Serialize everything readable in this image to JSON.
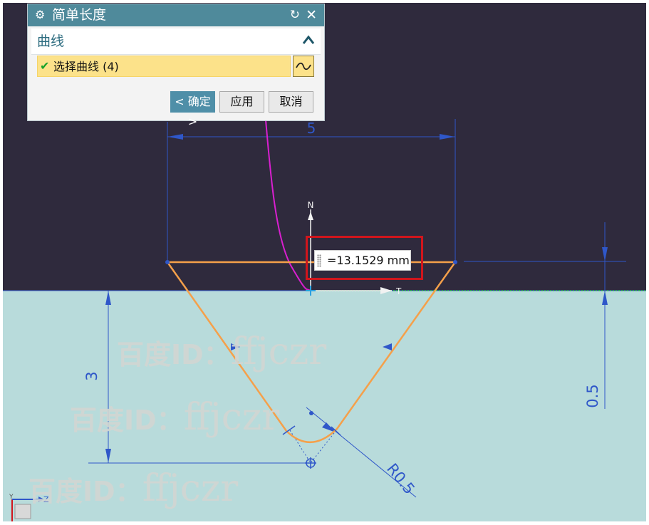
{
  "dialog": {
    "title": "简单长度",
    "icons": {
      "settings": "gear-icon",
      "reset": "reset-icon",
      "close": "close-icon"
    },
    "section": {
      "title": "曲线",
      "collapse_icon": "chevron-up-icon"
    },
    "select_curve": {
      "label": "选择曲线 (4)",
      "check_icon": "check-icon",
      "curve_icon": "curve-icon"
    },
    "buttons": {
      "ok": "< 确定 >",
      "apply": "应用",
      "cancel": "取消"
    }
  },
  "measure": {
    "value": "=13.1529 mm"
  },
  "sketch": {
    "dimensions": {
      "top_width": "5",
      "depth": "3",
      "offset": "0.5",
      "radius": "R0.5"
    },
    "axes": {
      "normal": "N",
      "tangent": "T",
      "triad_y": "Y",
      "triad_z": "Z"
    }
  },
  "watermark": {
    "brand": "百度ID：",
    "user": "ffjczr"
  },
  "colors": {
    "upper_bg": "#2f2a3d",
    "lower_bg": "#b8dbdb",
    "titlebar": "#4f8a9b",
    "highlight": "#fce28a",
    "profile": "#f5a04a",
    "dimension": "#2f57c9",
    "curve": "#d91fd0",
    "callout_border": "#d1151c"
  }
}
